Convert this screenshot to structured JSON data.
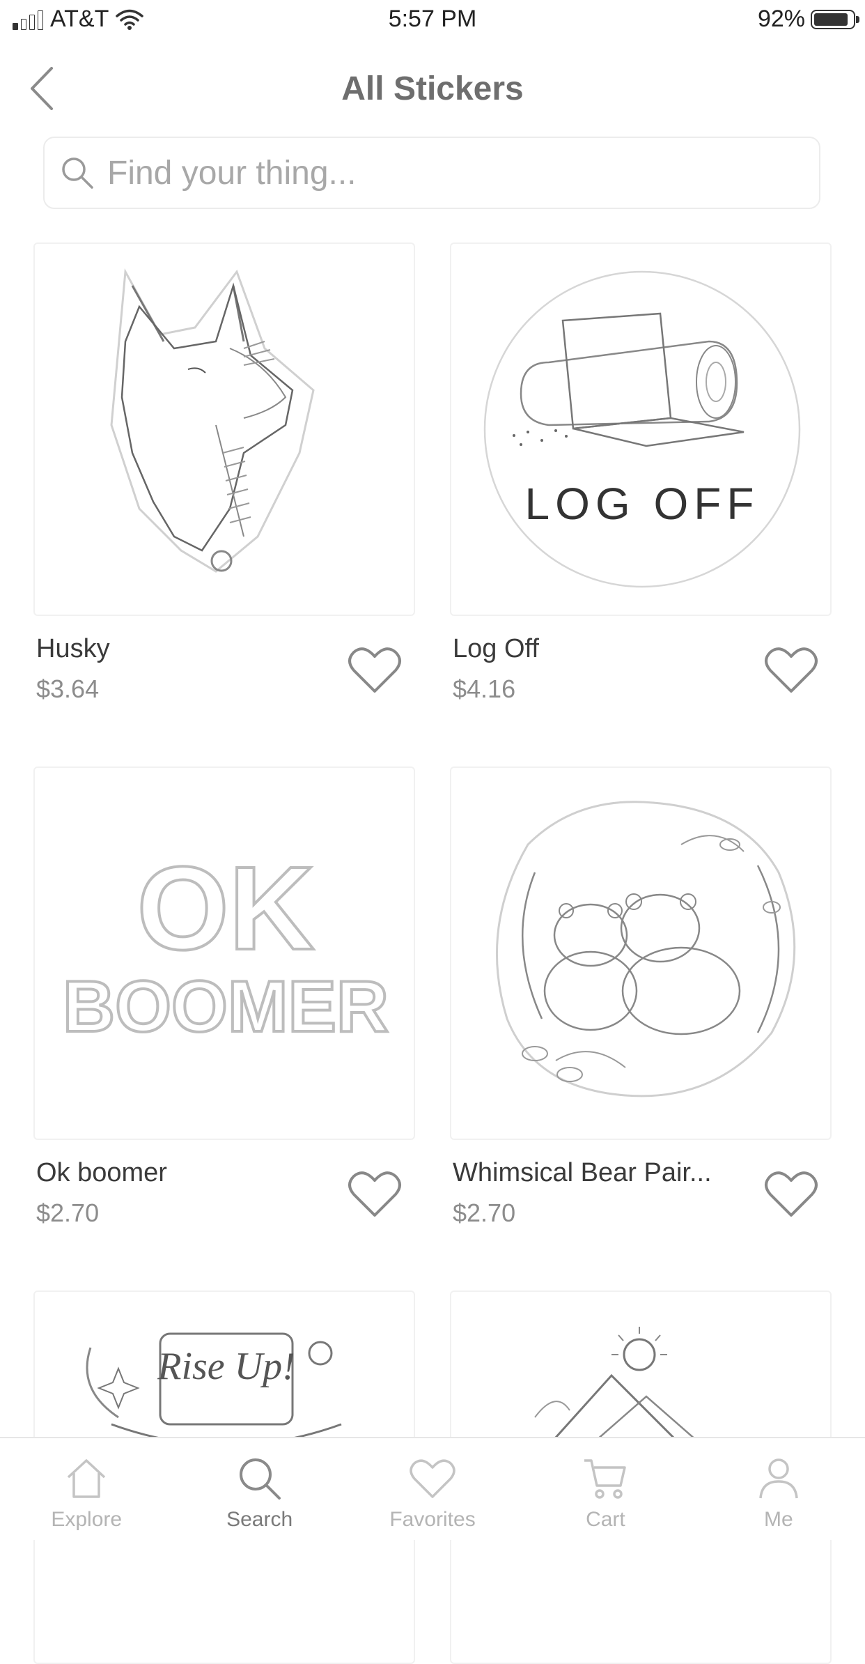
{
  "status_bar": {
    "carrier": "AT&T",
    "time": "5:57 PM",
    "battery": "92%",
    "battery_level": 0.92
  },
  "nav": {
    "title": "All Stickers",
    "back_icon": "chevron-left-icon"
  },
  "search": {
    "placeholder": "Find your thing..."
  },
  "products": [
    {
      "name": "Husky",
      "price": "$3.64",
      "favorite": false
    },
    {
      "name": "Log Off",
      "price": "$4.16",
      "favorite": false,
      "art_text": "LOG OFF"
    },
    {
      "name": "Ok boomer",
      "price": "$2.70",
      "favorite": false,
      "art_text_1": "OK",
      "art_text_2": "BOOMER"
    },
    {
      "name": "Whimsical Bear Pair...",
      "price": "$2.70",
      "favorite": false
    },
    {
      "art_text": "Rise Up!"
    },
    {}
  ],
  "tabs": [
    {
      "label": "Explore",
      "icon": "home-icon",
      "active": false
    },
    {
      "label": "Search",
      "icon": "search-icon",
      "active": true
    },
    {
      "label": "Favorites",
      "icon": "heart-icon",
      "active": false
    },
    {
      "label": "Cart",
      "icon": "cart-icon",
      "active": false
    },
    {
      "label": "Me",
      "icon": "person-icon",
      "active": false
    }
  ],
  "colors": {
    "text": "#333333",
    "muted": "#8c8c8c",
    "divider": "#e6e6e6"
  }
}
